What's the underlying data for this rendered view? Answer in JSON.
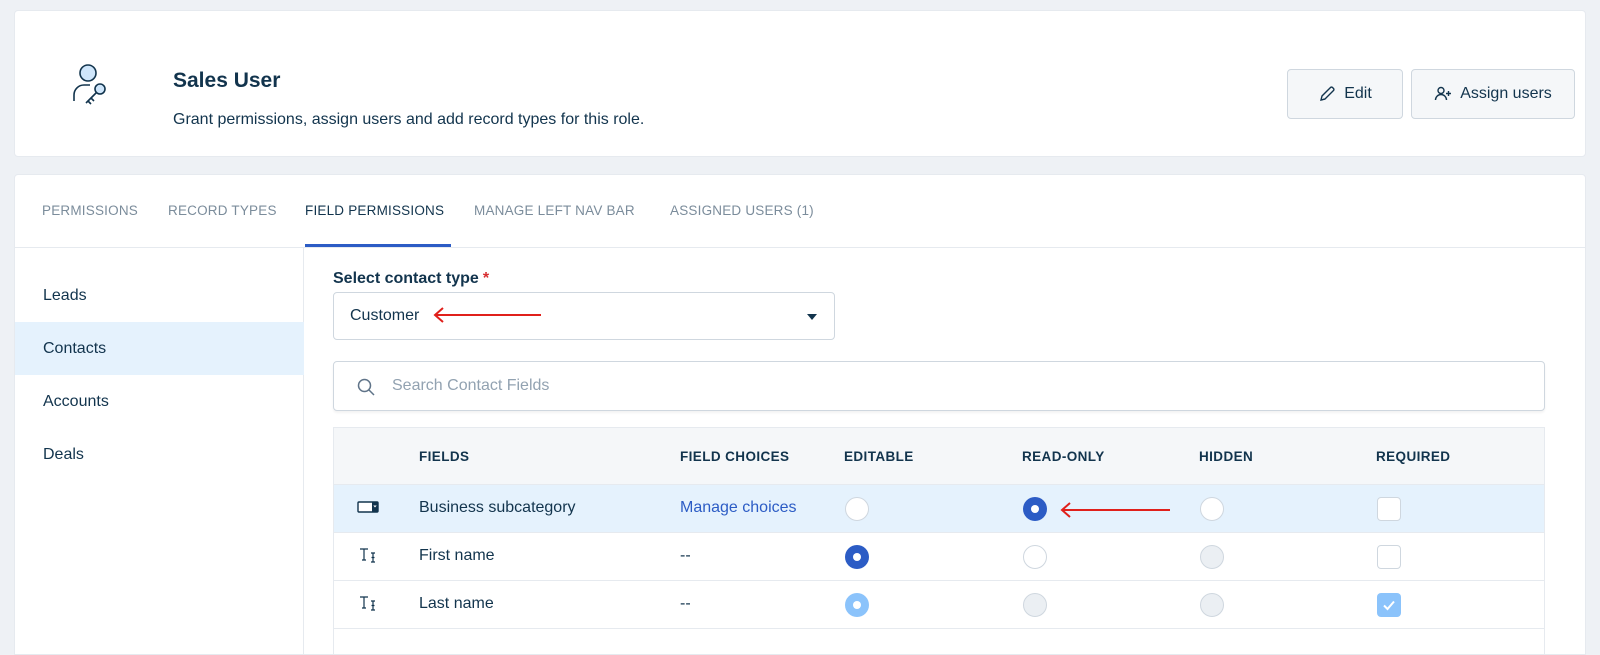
{
  "header": {
    "role_icon": "user-key-icon",
    "title": "Sales User",
    "subtitle": "Grant permissions, assign users and add record types for this role.",
    "edit_label": "Edit",
    "edit_icon": "pencil-icon",
    "assign_label": "Assign users",
    "assign_icon": "user-plus-icon"
  },
  "tabs": [
    {
      "label": "PERMISSIONS",
      "active": false
    },
    {
      "label": "RECORD TYPES",
      "active": false
    },
    {
      "label": "FIELD PERMISSIONS",
      "active": true
    },
    {
      "label": "MANAGE LEFT NAV BAR",
      "active": false
    },
    {
      "label": "ASSIGNED USERS (1)",
      "active": false
    }
  ],
  "sidebar": {
    "items": [
      {
        "label": "Leads",
        "active": false
      },
      {
        "label": "Contacts",
        "active": true
      },
      {
        "label": "Accounts",
        "active": false
      },
      {
        "label": "Deals",
        "active": false
      }
    ]
  },
  "contact_type": {
    "label": "Select contact type",
    "required_mark": "*",
    "value": "Customer"
  },
  "search": {
    "placeholder": "Search Contact Fields",
    "value": ""
  },
  "table": {
    "headers": {
      "fields": "FIELDS",
      "field_choices": "FIELD CHOICES",
      "editable": "EDITABLE",
      "read_only": "READ-ONLY",
      "hidden": "HIDDEN",
      "required": "REQUIRED"
    },
    "rows": [
      {
        "icon": "dropdown-field-icon",
        "name": "Business subcategory",
        "choices": "Manage choices",
        "choices_is_link": true,
        "editable": "unchecked",
        "read_only": "checked",
        "hidden": "unchecked",
        "required": "unchecked",
        "highlighted": true
      },
      {
        "icon": "text-field-icon",
        "name": "First name",
        "choices": "--",
        "choices_is_link": false,
        "editable": "checked",
        "read_only": "unchecked",
        "hidden": "disabled",
        "required": "unchecked",
        "highlighted": false
      },
      {
        "icon": "text-field-icon",
        "name": "Last name",
        "choices": "--",
        "choices_is_link": false,
        "editable": "checked-disabled",
        "read_only": "disabled",
        "hidden": "disabled",
        "required": "checked-disabled",
        "highlighted": false
      }
    ]
  },
  "colors": {
    "primary": "#2c5cc5",
    "primary_light": "#8bc3fb",
    "highlight_row": "#e5f2fd",
    "annotation_arrow": "#e0201b",
    "required_star": "#d72d30"
  }
}
